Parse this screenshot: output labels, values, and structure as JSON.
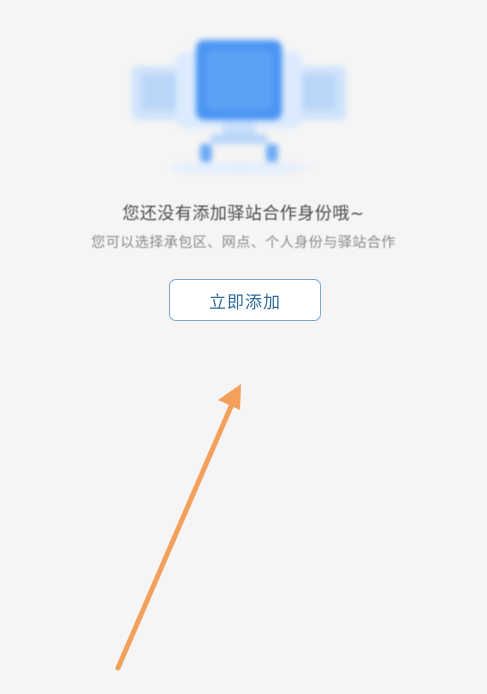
{
  "empty_state": {
    "title": "您还没有添加驿站合作身份哦~",
    "subtitle": "您可以选择承包区、网点、个人身份与驿站合作",
    "add_button_label": "立即添加"
  },
  "colors": {
    "background": "#f5f5f5",
    "button_border": "#7fa6c3",
    "button_text": "#2f6a99",
    "illustration_blue": "#3d8ef2",
    "arrow": "#f3a05c"
  }
}
